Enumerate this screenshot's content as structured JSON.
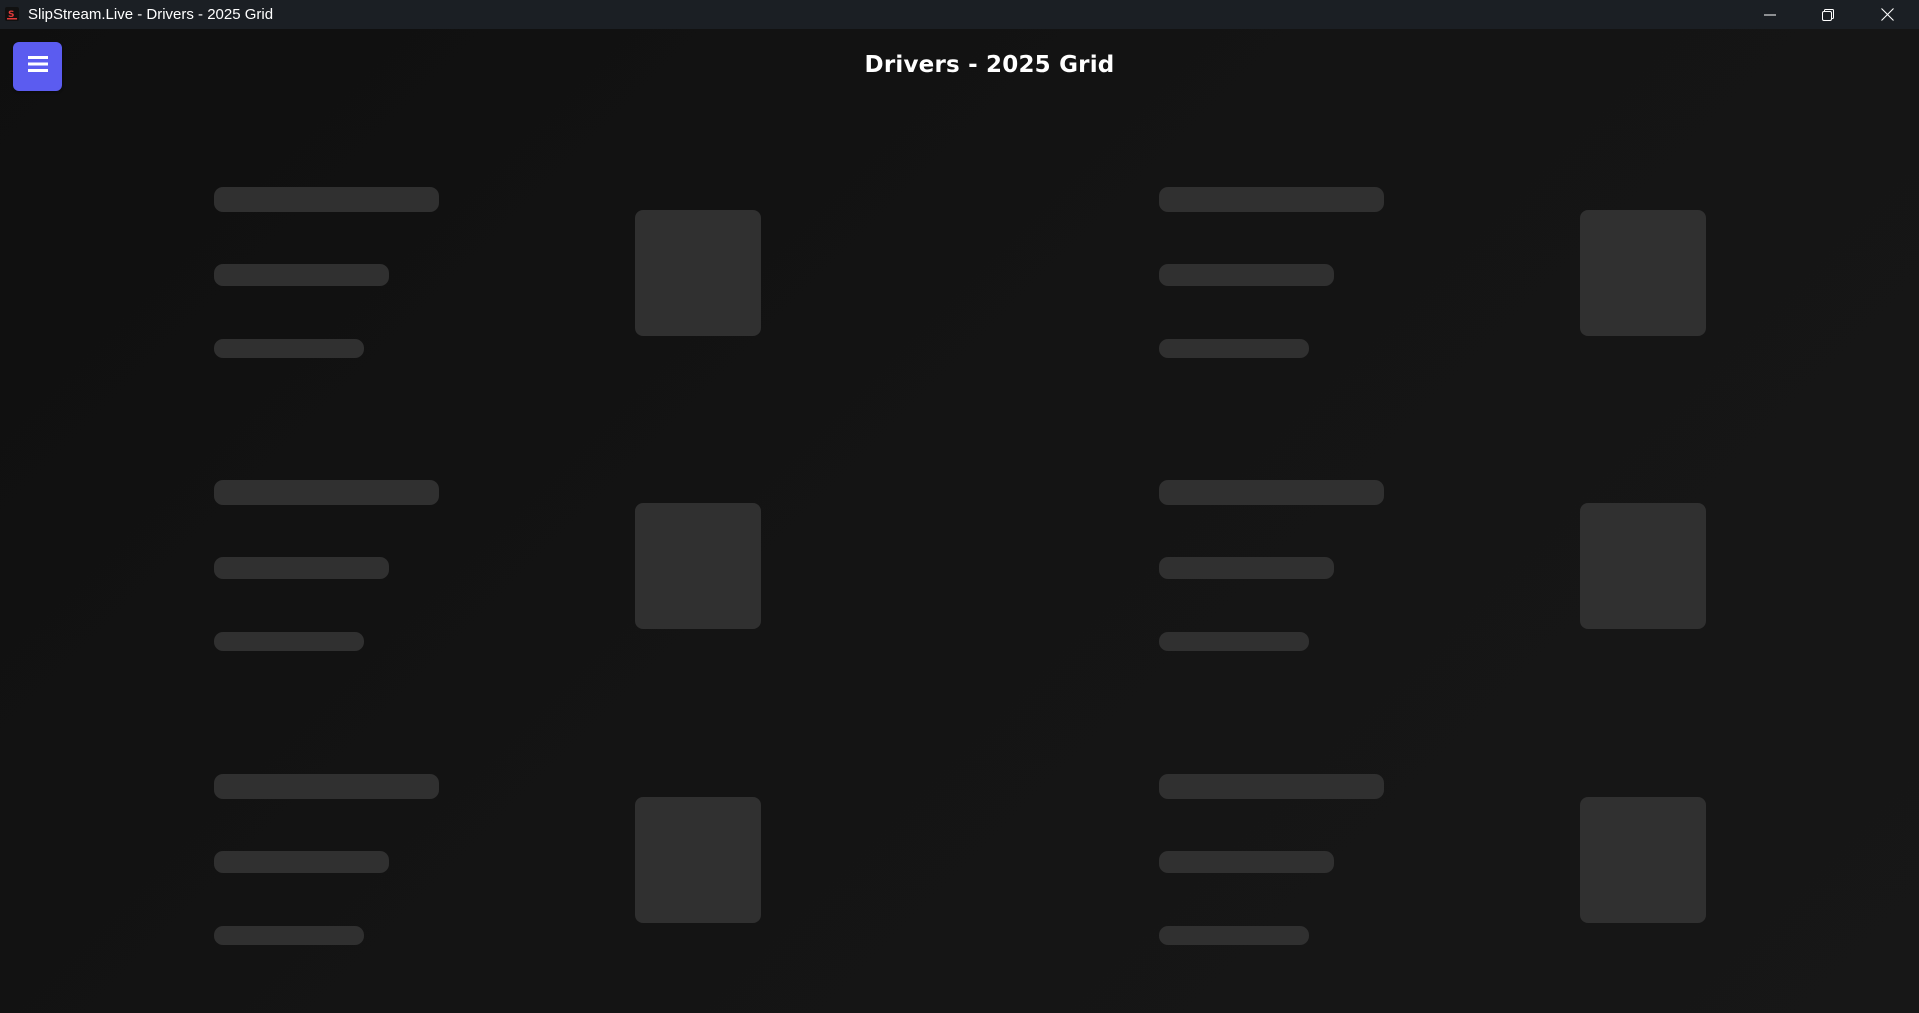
{
  "window": {
    "title": "SlipStream.Live - Drivers - 2025 Grid",
    "app_icon": "slipstream-logo-icon",
    "controls": [
      "minimize-icon",
      "restore-icon",
      "close-icon"
    ]
  },
  "header": {
    "menu_icon": "hamburger-menu-icon",
    "menu_color": "#5b5cf0",
    "title": "Drivers - 2025 Grid"
  },
  "grid": {
    "state": "loading",
    "columns": 2,
    "rows": 3,
    "placeholder_color": "#303030",
    "cards": [
      {
        "id": "driver-card-1"
      },
      {
        "id": "driver-card-2"
      },
      {
        "id": "driver-card-3"
      },
      {
        "id": "driver-card-4"
      },
      {
        "id": "driver-card-5"
      },
      {
        "id": "driver-card-6"
      }
    ]
  }
}
